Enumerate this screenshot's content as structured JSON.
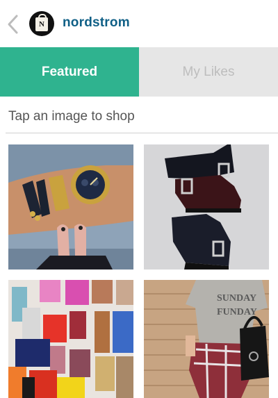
{
  "header": {
    "brand_name": "nordstrom",
    "avatar_letter": "N",
    "back_icon": "chevron-left-icon",
    "avatar_icon": "shopping-bag-logo"
  },
  "tabs": [
    {
      "label": "Featured",
      "selected": true
    },
    {
      "label": "My Likes",
      "selected": false
    }
  ],
  "hint_text": "Tap an image to shop",
  "colors": {
    "accent": "#2fb38f",
    "brand": "#0f5f86",
    "tab_inactive_bg": "#e6e6e6",
    "tab_inactive_text": "#bdbdbd"
  },
  "gallery": [
    {
      "subject": "watch and bracelets on wrist with pink shoes"
    },
    {
      "subject": "three pairs of black buckled ankle boots"
    },
    {
      "subject": "assorted nail polish bottles"
    },
    {
      "subject": "gray graphic tee, plaid shirt and black handbag"
    }
  ]
}
